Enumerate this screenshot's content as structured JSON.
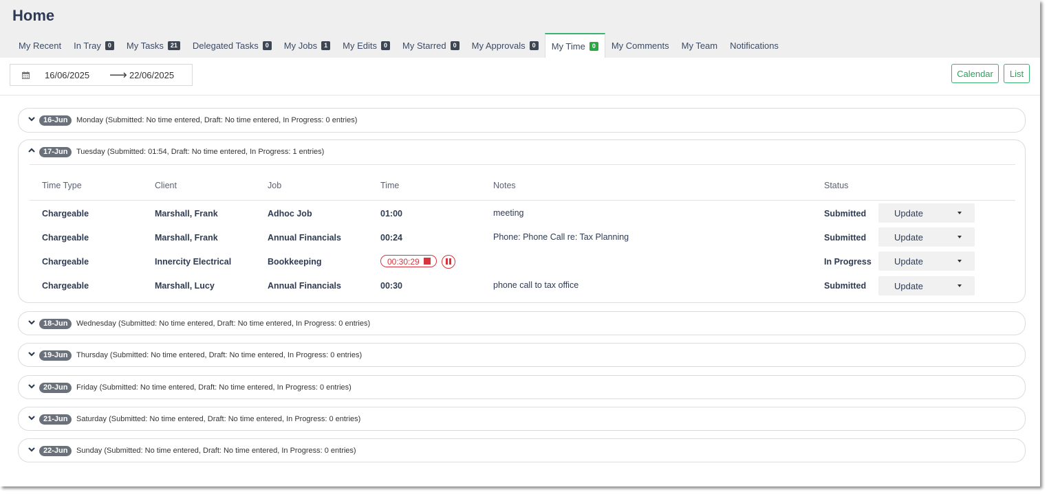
{
  "page": {
    "title": "Home"
  },
  "tabs": [
    {
      "label": "My Recent",
      "badge": ""
    },
    {
      "label": "In Tray",
      "badge": "0"
    },
    {
      "label": "My Tasks",
      "badge": "21"
    },
    {
      "label": "Delegated Tasks",
      "badge": "0"
    },
    {
      "label": "My Jobs",
      "badge": "1"
    },
    {
      "label": "My Edits",
      "badge": "0"
    },
    {
      "label": "My Starred",
      "badge": "0"
    },
    {
      "label": "My Approvals",
      "badge": "0"
    },
    {
      "label": "My Time",
      "badge": "0"
    },
    {
      "label": "My Comments",
      "badge": ""
    },
    {
      "label": "My Team",
      "badge": ""
    },
    {
      "label": "Notifications",
      "badge": ""
    }
  ],
  "active_tab": "My Time",
  "date_range": {
    "from": "16/06/2025",
    "arrow": "⟶",
    "to": "22/06/2025"
  },
  "view_buttons": {
    "calendar": "Calendar",
    "list": "List"
  },
  "days": [
    {
      "badge": "16-Jun",
      "summary": "Monday (Submitted: No time entered, Draft: No time entered, In Progress: 0 entries)",
      "expanded": false
    },
    {
      "badge": "17-Jun",
      "summary": "Tuesday (Submitted: 01:54, Draft: No time entered, In Progress: 1 entries)",
      "expanded": true
    },
    {
      "badge": "18-Jun",
      "summary": "Wednesday (Submitted: No time entered, Draft: No time entered, In Progress: 0 entries)",
      "expanded": false
    },
    {
      "badge": "19-Jun",
      "summary": "Thursday (Submitted: No time entered, Draft: No time entered, In Progress: 0 entries)",
      "expanded": false
    },
    {
      "badge": "20-Jun",
      "summary": "Friday (Submitted: No time entered, Draft: No time entered, In Progress: 0 entries)",
      "expanded": false
    },
    {
      "badge": "21-Jun",
      "summary": "Saturday (Submitted: No time entered, Draft: No time entered, In Progress: 0 entries)",
      "expanded": false
    },
    {
      "badge": "22-Jun",
      "summary": "Sunday (Submitted: No time entered, Draft: No time entered, In Progress: 0 entries)",
      "expanded": false
    }
  ],
  "table": {
    "headers": {
      "time_type": "Time Type",
      "client": "Client",
      "job": "Job",
      "time": "Time",
      "notes": "Notes",
      "status": "Status"
    },
    "rows": [
      {
        "time_type": "Chargeable",
        "client": "Marshall, Frank",
        "job": "Adhoc Job",
        "time": "01:00",
        "notes": "meeting",
        "status": "Submitted",
        "action": "Update"
      },
      {
        "time_type": "Chargeable",
        "client": "Marshall, Frank",
        "job": "Annual Financials",
        "time": "00:24",
        "notes": "Phone: Phone Call re: Tax Planning",
        "status": "Submitted",
        "action": "Update"
      },
      {
        "time_type": "Chargeable",
        "client": "Innercity Electrical",
        "job": "Bookkeeping",
        "time": "00:30:29",
        "notes": "",
        "status": "In Progress",
        "action": "Update",
        "running": true
      },
      {
        "time_type": "Chargeable",
        "client": "Marshall, Lucy",
        "job": "Annual Financials",
        "time": "00:30",
        "notes": "phone call to tax office",
        "status": "Submitted",
        "action": "Update"
      }
    ]
  },
  "colors": {
    "accent_green": "#3bb273",
    "timer_red": "#d9343b",
    "badge_dark": "#3f4653",
    "day_badge": "#6b717b"
  },
  "icons": {
    "date": "calendar-icon",
    "expand": "chevron-down-icon",
    "collapse": "chevron-up-icon",
    "stop": "stop-icon",
    "pause": "pause-icon",
    "dropdown": "caret-down-icon"
  }
}
